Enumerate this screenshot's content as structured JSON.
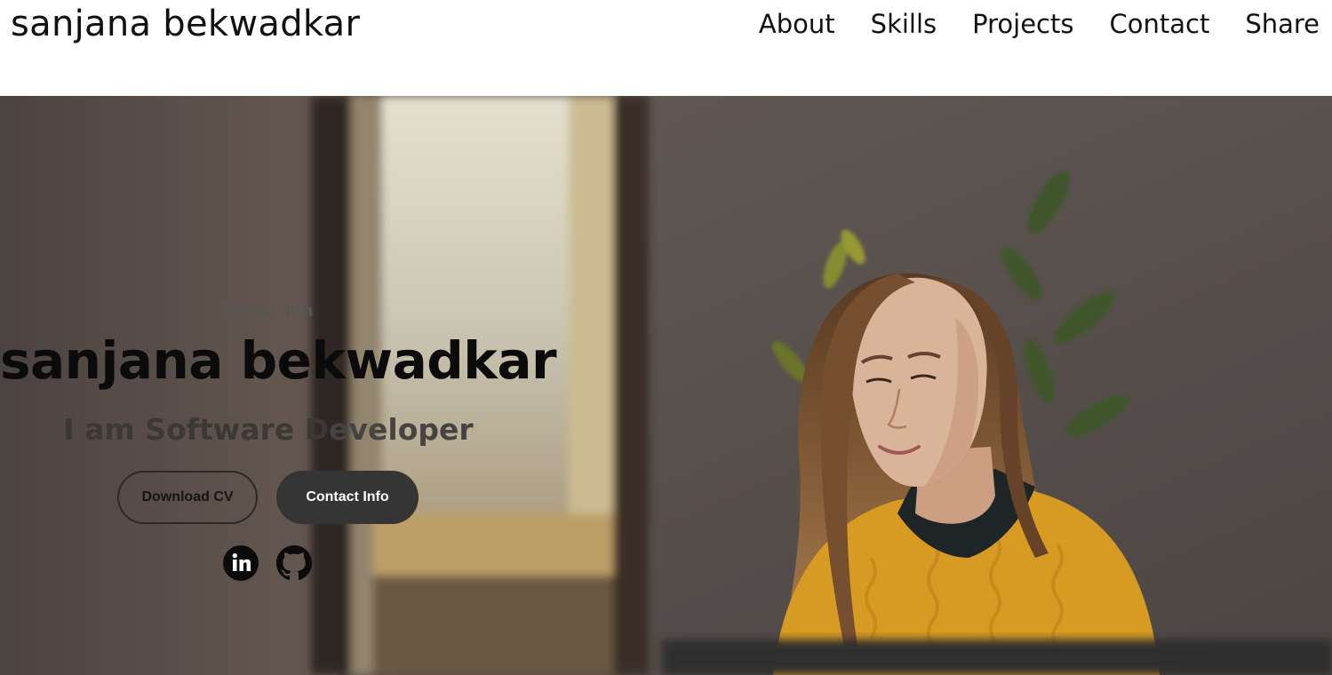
{
  "header": {
    "logo": "sanjana bekwadkar",
    "nav": [
      {
        "label": "About"
      },
      {
        "label": "Skills"
      },
      {
        "label": "Projects"
      },
      {
        "label": "Contact"
      },
      {
        "label": "Share"
      }
    ]
  },
  "hero": {
    "greeting": "Hello, I'm",
    "name": "sanjana bekwadkar",
    "role_part1": "I am Software D",
    "role_part2": "eveloper",
    "buttons": {
      "download_cv": "Download CV",
      "contact_info": "Contact Info"
    },
    "social": [
      {
        "icon": "linkedin-icon"
      },
      {
        "icon": "github-icon"
      }
    ]
  },
  "colors": {
    "text_dark": "#111111",
    "button_dark": "#353535",
    "sweater": "#e6a521",
    "wall": "#5e5552"
  }
}
